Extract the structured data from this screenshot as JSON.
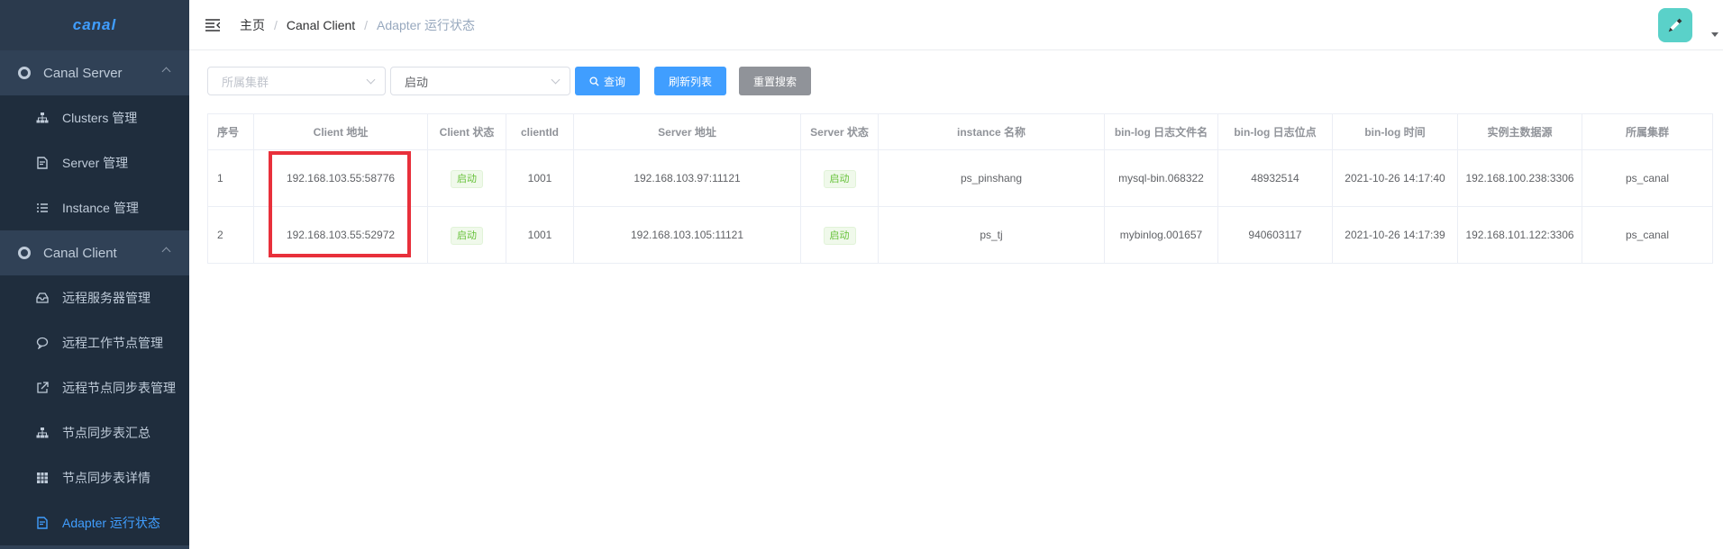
{
  "sidebar": {
    "logo": "canal",
    "groups": [
      {
        "label": "Canal Server",
        "icon": "server-group-icon"
      },
      {
        "label": "Canal Client",
        "icon": "client-group-icon"
      }
    ],
    "server_items": [
      {
        "label": "Clusters 管理",
        "icon": "sitemap-icon"
      },
      {
        "label": "Server 管理",
        "icon": "document-edit-icon"
      },
      {
        "label": "Instance 管理",
        "icon": "list-icon"
      }
    ],
    "client_items": [
      {
        "label": "远程服务器管理",
        "icon": "inbox-icon"
      },
      {
        "label": "远程工作节点管理",
        "icon": "chat-icon"
      },
      {
        "label": "远程节点同步表管理",
        "icon": "external-link-icon"
      },
      {
        "label": "节点同步表汇总",
        "icon": "sitemap-icon"
      },
      {
        "label": "节点同步表详情",
        "icon": "table-icon"
      },
      {
        "label": "Adapter 运行状态",
        "icon": "document-edit-icon"
      }
    ],
    "active_color": "#409eff"
  },
  "header": {
    "breadcrumb": [
      "主页",
      "Canal Client",
      "Adapter 运行状态"
    ]
  },
  "filters": {
    "cluster_placeholder": "所属集群",
    "status_value": "启动",
    "search_label": "查询",
    "refresh_label": "刷新列表",
    "reset_label": "重置搜索"
  },
  "table": {
    "columns": [
      "序号",
      "Client 地址",
      "Client 状态",
      "clientId",
      "Server 地址",
      "Server 状态",
      "instance 名称",
      "bin-log 日志文件名",
      "bin-log 日志位点",
      "bin-log 时间",
      "实例主数据源",
      "所属集群"
    ],
    "rows": [
      {
        "index": "1",
        "client_addr": "192.168.103.55:58776",
        "client_status": "启动",
        "client_id": "1001",
        "server_addr": "192.168.103.97:11121",
        "server_status": "启动",
        "instance": "ps_pinshang",
        "binlog_file": "mysql-bin.068322",
        "binlog_pos": "48932514",
        "binlog_time": "2021-10-26 14:17:40",
        "master_source": "192.168.100.238:3306",
        "cluster": "ps_canal"
      },
      {
        "index": "2",
        "client_addr": "192.168.103.55:52972",
        "client_status": "启动",
        "client_id": "1001",
        "server_addr": "192.168.103.105:11121",
        "server_status": "启动",
        "instance": "ps_tj",
        "binlog_file": "mybinlog.001657",
        "binlog_pos": "940603117",
        "binlog_time": "2021-10-26 14:17:39",
        "master_source": "192.168.101.122:3306",
        "cluster": "ps_canal"
      }
    ]
  },
  "colors": {
    "sidebar_bg": "#304156",
    "primary": "#409eff",
    "success": "#67c23a",
    "highlight": "#e8303b"
  }
}
